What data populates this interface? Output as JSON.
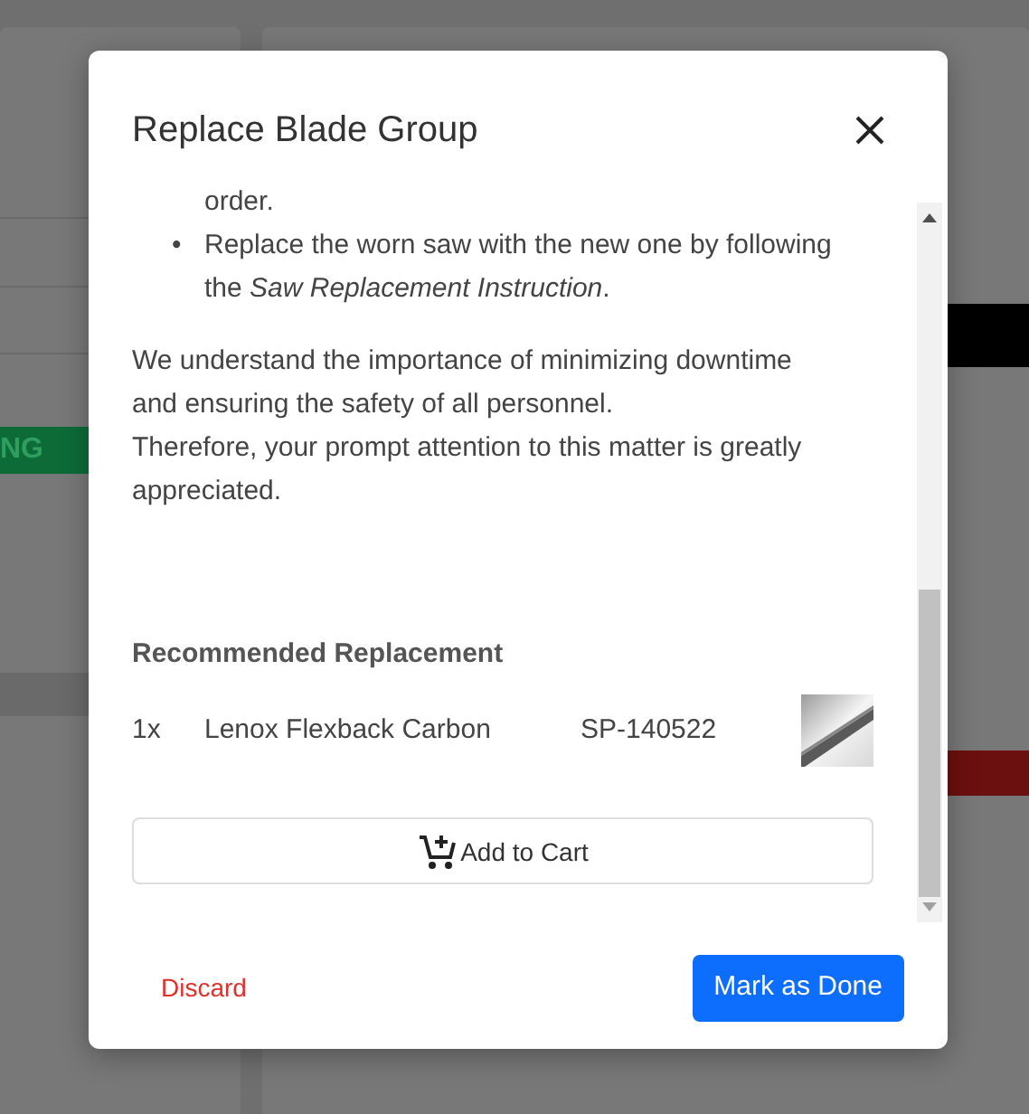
{
  "background": {
    "badge": "NG"
  },
  "dialog": {
    "title": "Replace Blade Group",
    "bullets": [
      {
        "text": "order."
      },
      {
        "marker": "•",
        "text": "Replace the worn saw with the new one by following the *Saw Replacement Instruction*."
      }
    ],
    "paragraphs": [
      "We understand the importance of minimizing downtime and ensuring the safety of all personnel.",
      "Therefore, your prompt attention to this matter is greatly appreciated."
    ],
    "recommended": {
      "heading": "Recommended Replacement",
      "items": [
        {
          "quantity": "1x",
          "name": "Lenox Flexback Carbon",
          "part_number": "SP-140522"
        }
      ],
      "add_button": "Add to Cart"
    },
    "discard": "Discard",
    "done": "Mark as Done"
  }
}
